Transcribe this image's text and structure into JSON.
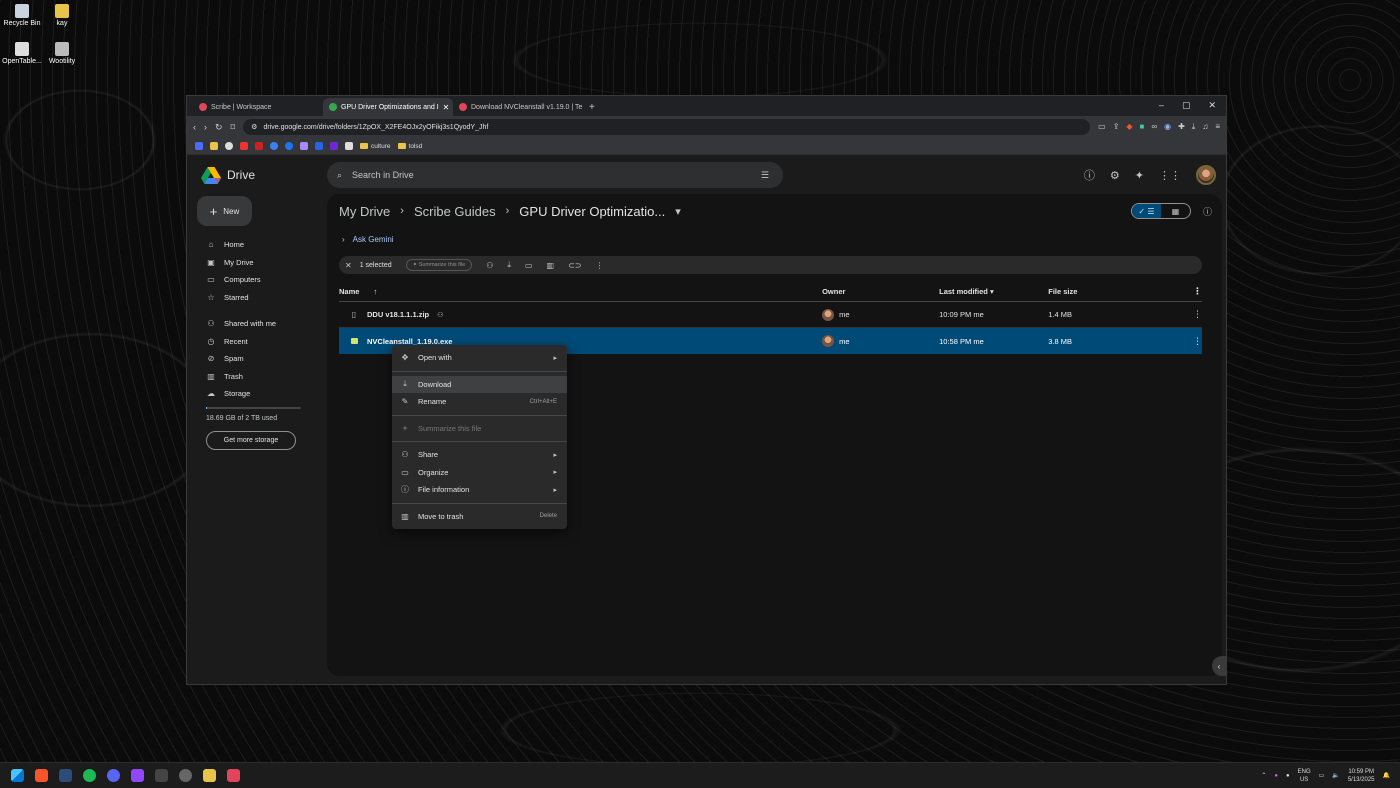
{
  "desktop": {
    "icons": [
      "Recycle Bin",
      "kay",
      "OpenTable...",
      "Wootility"
    ]
  },
  "browser": {
    "tabs": [
      {
        "title": "Scribe | Workspace",
        "color": "#e0455a"
      },
      {
        "title": "GPU Driver Optimizations and I",
        "color": "#34a853"
      },
      {
        "title": "Download NVCleanstall v1.19.0 | Te",
        "color": "#e0455a"
      }
    ],
    "new_tab": "+",
    "controls": {
      "min": "–",
      "max": "▢",
      "close": "✕"
    },
    "url": "drive.google.com/drive/folders/1ZpOX_X2FE4OJx2yOFikj3s1QyodY_Jhf",
    "bookmarks": [
      {
        "label": "culture"
      },
      {
        "label": "tolsd"
      }
    ]
  },
  "drive": {
    "app_name": "Drive",
    "search_placeholder": "Search in Drive",
    "new_button": "New",
    "nav": [
      {
        "label": "Home",
        "icon": "home-icon",
        "glyph": "⌂"
      },
      {
        "label": "My Drive",
        "icon": "my-drive-icon",
        "glyph": "▣"
      },
      {
        "label": "Computers",
        "icon": "computer-icon",
        "glyph": "▭"
      },
      {
        "label": "Starred",
        "icon": "star-icon",
        "glyph": "☆"
      },
      {
        "label": "Shared with me",
        "icon": "shared-icon",
        "glyph": "👥"
      },
      {
        "label": "Recent",
        "icon": "clock-icon",
        "glyph": "◷"
      },
      {
        "label": "Spam",
        "icon": "spam-icon",
        "glyph": "⊘"
      },
      {
        "label": "Trash",
        "icon": "trash-icon",
        "glyph": "🗑"
      },
      {
        "label": "Storage",
        "icon": "cloud-icon",
        "glyph": "☁"
      }
    ],
    "storage_used": "18.69 GB of 2 TB used",
    "get_storage": "Get more storage",
    "breadcrumb": [
      "My Drive",
      "Scribe Guides",
      "GPU Driver Optimizatio..."
    ],
    "ask_gemini": "Ask Gemini",
    "selection": {
      "count_label": "1 selected",
      "summarize": "Summarize this file"
    },
    "columns": {
      "name": "Name",
      "owner": "Owner",
      "modified": "Last modified",
      "size": "File size"
    },
    "files": [
      {
        "name": "DDU v18.1.1.1.zip",
        "owner": "me",
        "modified": "10:09 PM",
        "modified_by": "me",
        "size": "1.4 MB",
        "selected": false
      },
      {
        "name": "NVCleanstall_1.19.0.exe",
        "owner": "me",
        "modified": "10:58 PM",
        "modified_by": "me",
        "size": "3.8 MB",
        "selected": true
      }
    ]
  },
  "context_menu": {
    "open_with": "Open with",
    "download": "Download",
    "rename": "Rename",
    "rename_shortcut": "Ctrl+Alt+E",
    "summarize": "Summarize this file",
    "share": "Share",
    "organize": "Organize",
    "file_info": "File information",
    "trash": "Move to trash",
    "trash_shortcut": "Delete"
  },
  "taskbar": {
    "lang_top": "ENG",
    "lang_bottom": "US",
    "time": "10:59 PM",
    "date": "5/13/2025"
  }
}
